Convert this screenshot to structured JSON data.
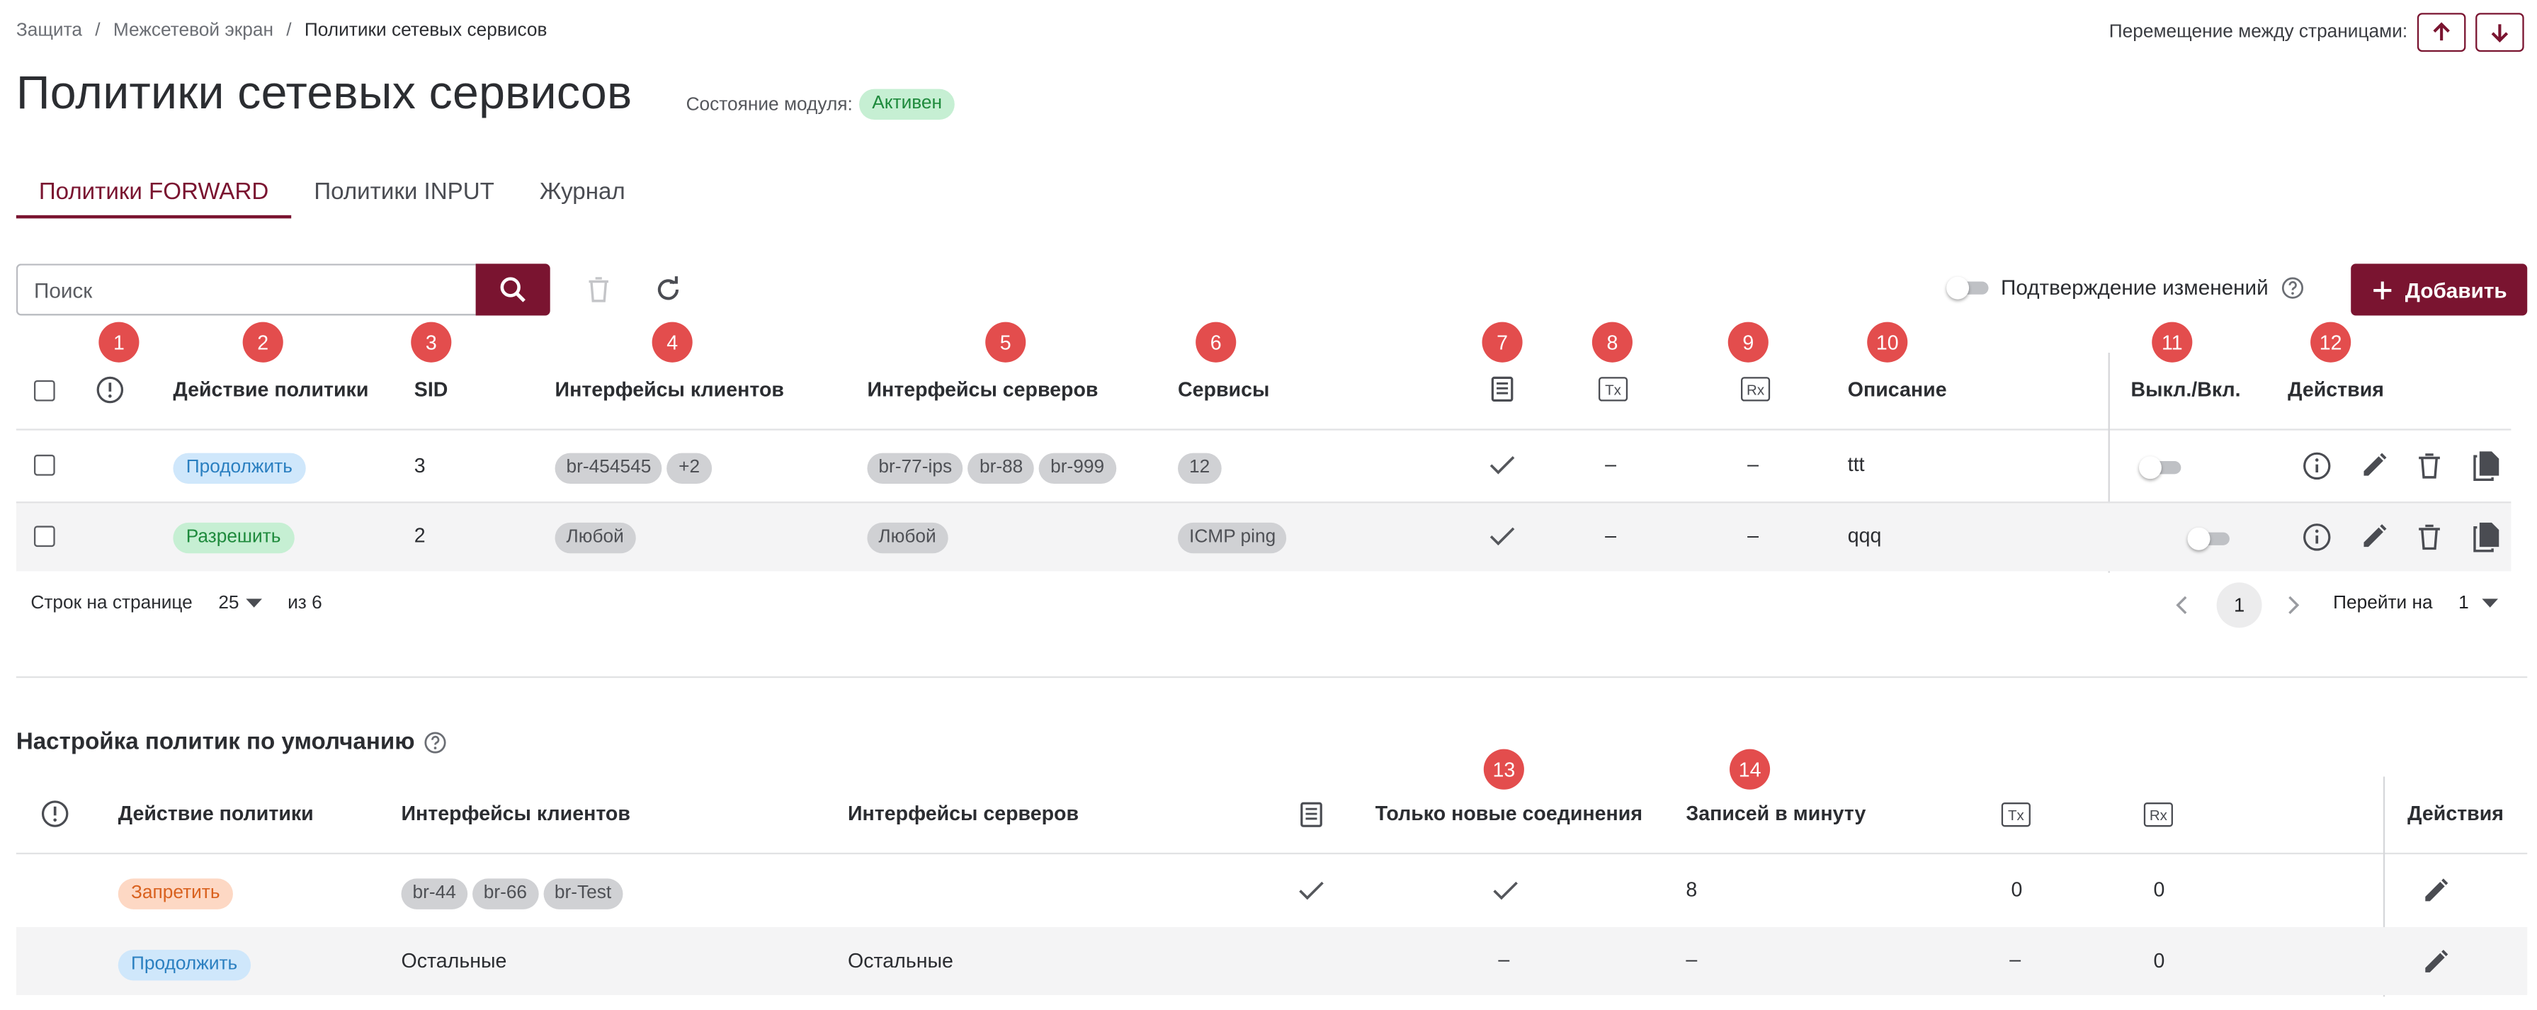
{
  "breadcrumb": [
    "Защита",
    "Межсетевой экран",
    "Политики сетевых сервисов"
  ],
  "nav": {
    "label": "Перемещение между страницами:"
  },
  "page": {
    "title": "Политики сетевых сервисов",
    "state_label": "Состояние модуля:",
    "state_value": "Активен"
  },
  "tabs": [
    {
      "label": "Политики FORWARD",
      "active": true
    },
    {
      "label": "Политики INPUT",
      "active": false
    },
    {
      "label": "Журнал",
      "active": false
    }
  ],
  "search": {
    "placeholder": "Поиск",
    "value": ""
  },
  "confirm_changes": {
    "label": "Подтверждение изменений",
    "enabled": false
  },
  "add_button": {
    "label": "Добавить"
  },
  "colors": {
    "accent": "#7a1430",
    "marker": "#e34d4d"
  },
  "markers": [
    "1",
    "2",
    "3",
    "4",
    "5",
    "6",
    "7",
    "8",
    "9",
    "10",
    "11",
    "12",
    "13",
    "14"
  ],
  "table": {
    "headers": {
      "action": "Действие политики",
      "sid": "SID",
      "clients": "Интерфейсы клиентов",
      "servers": "Интерфейсы серверов",
      "services": "Сервисы",
      "tx": "Tx",
      "rx": "Rx",
      "description": "Описание",
      "onoff": "Выкл./Вкл.",
      "actions": "Действия"
    },
    "rows": [
      {
        "action": "Продолжить",
        "sid": "3",
        "clients": [
          "br-454545",
          "+2"
        ],
        "servers": [
          "br-77-ips",
          "br-88",
          "br-999"
        ],
        "services": [
          "12"
        ],
        "log": true,
        "tx": "–",
        "rx": "–",
        "description": "ttt",
        "enabled": false
      },
      {
        "action": "Разрешить",
        "sid": "2",
        "clients": [
          "Любой"
        ],
        "servers": [
          "Любой"
        ],
        "services": [
          "ICMP ping"
        ],
        "log": true,
        "tx": "–",
        "rx": "–",
        "description": "qqq",
        "enabled": false
      }
    ]
  },
  "pagination": {
    "rows_label": "Строк на странице",
    "rows_value": "25",
    "of_label": "из 6",
    "current_page": "1",
    "goto_label": "Перейти на",
    "goto_value": "1"
  },
  "defaults": {
    "title": "Настройка политик по умолчанию",
    "headers": {
      "action": "Действие политики",
      "clients": "Интерфейсы клиентов",
      "servers": "Интерфейсы серверов",
      "new_only": "Только новые соединения",
      "per_min": "Записей в минуту",
      "tx": "Tx",
      "rx": "Rx",
      "actions": "Действия"
    },
    "rows": [
      {
        "action": "Запретить",
        "clients": [
          "br-44",
          "br-66",
          "br-Test"
        ],
        "servers": "",
        "log": true,
        "new_only": "check",
        "per_min": "8",
        "tx": "0",
        "rx": "0"
      },
      {
        "action": "Продолжить",
        "clients_text": "Остальные",
        "servers": "Остальные",
        "log": false,
        "new_only": "–",
        "per_min": "–",
        "tx": "–",
        "rx": "0"
      }
    ]
  }
}
